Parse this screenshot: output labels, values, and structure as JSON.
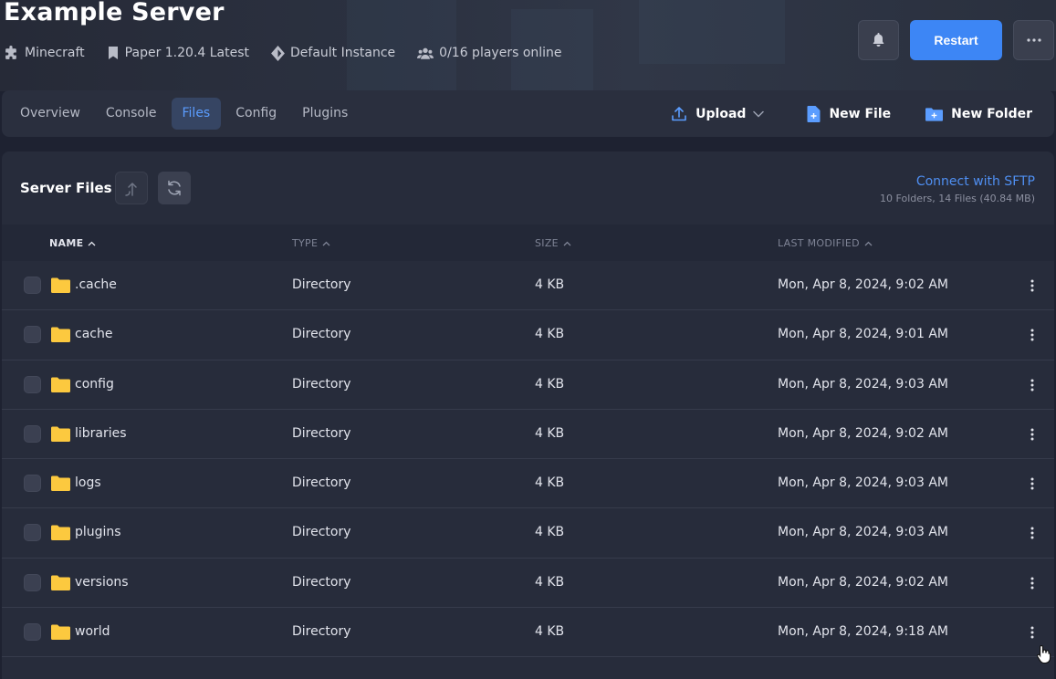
{
  "header": {
    "title": "Example Server",
    "meta": {
      "game": "Minecraft",
      "version": "Paper 1.20.4 Latest",
      "instance": "Default Instance",
      "players": "0/16 players online"
    },
    "restart_label": "Restart",
    "icons": {
      "notifications": "bell-icon",
      "more": "ellipsis-icon"
    }
  },
  "nav": {
    "tabs": [
      {
        "label": "Overview",
        "active": false
      },
      {
        "label": "Console",
        "active": false
      },
      {
        "label": "Files",
        "active": true
      },
      {
        "label": "Config",
        "active": false
      },
      {
        "label": "Plugins",
        "active": false
      }
    ],
    "actions": {
      "upload": "Upload",
      "new_file": "New File",
      "new_folder": "New Folder"
    }
  },
  "files": {
    "title": "Server Files",
    "sftp_link": "Connect with SFTP",
    "summary": "10 Folders, 14 Files (40.84 MB)",
    "columns": {
      "name": "NAME",
      "type": "TYPE",
      "size": "SIZE",
      "modified": "LAST MODIFIED"
    },
    "rows": [
      {
        "name": ".cache",
        "type": "Directory",
        "size": "4 KB",
        "modified": "Mon, Apr 8, 2024, 9:02 AM"
      },
      {
        "name": "cache",
        "type": "Directory",
        "size": "4 KB",
        "modified": "Mon, Apr 8, 2024, 9:01 AM"
      },
      {
        "name": "config",
        "type": "Directory",
        "size": "4 KB",
        "modified": "Mon, Apr 8, 2024, 9:03 AM"
      },
      {
        "name": "libraries",
        "type": "Directory",
        "size": "4 KB",
        "modified": "Mon, Apr 8, 2024, 9:02 AM"
      },
      {
        "name": "logs",
        "type": "Directory",
        "size": "4 KB",
        "modified": "Mon, Apr 8, 2024, 9:03 AM"
      },
      {
        "name": "plugins",
        "type": "Directory",
        "size": "4 KB",
        "modified": "Mon, Apr 8, 2024, 9:03 AM"
      },
      {
        "name": "versions",
        "type": "Directory",
        "size": "4 KB",
        "modified": "Mon, Apr 8, 2024, 9:02 AM"
      },
      {
        "name": "world",
        "type": "Directory",
        "size": "4 KB",
        "modified": "Mon, Apr 8, 2024, 9:18 AM"
      }
    ]
  },
  "colors": {
    "accent": "#3d86f5",
    "folder": "#fcc93f",
    "background": "#1e2231",
    "panel": "#272c3b"
  }
}
